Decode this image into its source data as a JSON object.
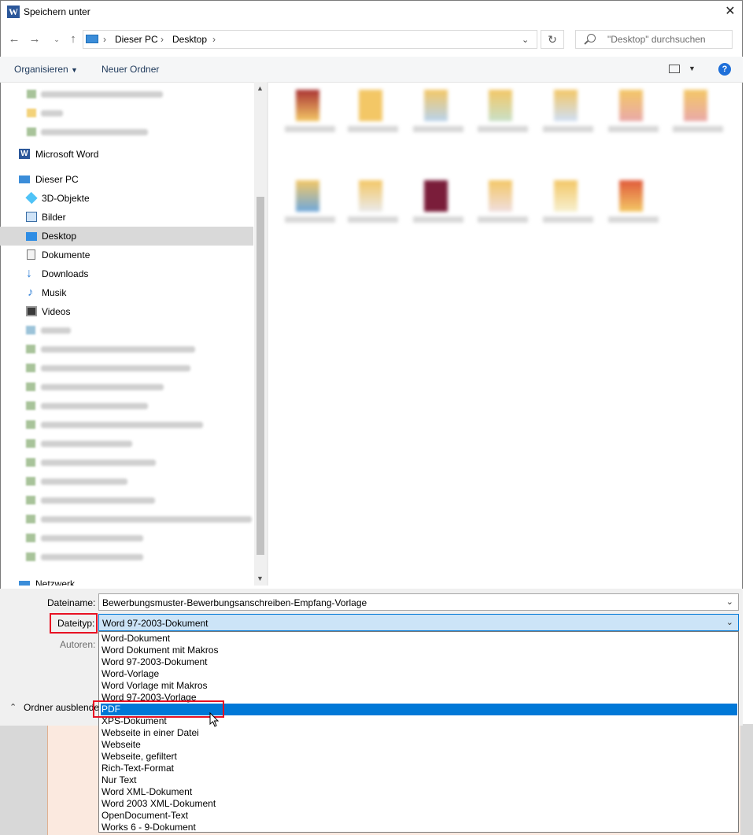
{
  "window": {
    "title": "Speichern unter",
    "app_icon": "W"
  },
  "breadcrumb": [
    "Dieser PC",
    "Desktop"
  ],
  "search": {
    "placeholder": "\"Desktop\" durchsuchen"
  },
  "toolbar": {
    "organize": "Organisieren",
    "new_folder": "Neuer Ordner"
  },
  "nav": {
    "microsoft_word": "Microsoft Word",
    "this_pc": "Dieser PC",
    "objects_3d": "3D-Objekte",
    "pictures": "Bilder",
    "desktop": "Desktop",
    "documents": "Dokumente",
    "downloads": "Downloads",
    "music": "Musik",
    "videos": "Videos",
    "network": "Netzwerk"
  },
  "form": {
    "filename_label": "Dateiname:",
    "filename_value": "Bewerbungsmuster-Bewerbungsanschreiben-Empfang-Vorlage",
    "filetype_label": "Dateityp:",
    "filetype_value": "Word 97-2003-Dokument",
    "authors_label": "Autoren:",
    "hide_folders": "Ordner ausblende"
  },
  "filetype_options": [
    "Word-Dokument",
    "Word Dokument mit Makros",
    "Word 97-2003-Dokument",
    "Word-Vorlage",
    "Word Vorlage mit Makros",
    "Word 97-2003-Vorlage",
    "PDF",
    "XPS-Dokument",
    "Webseite in einer Datei",
    "Webseite",
    "Webseite, gefiltert",
    "Rich-Text-Format",
    "Nur Text",
    "Word XML-Dokument",
    "Word 2003 XML-Dokument",
    "OpenDocument-Text",
    "Works 6 - 9-Dokument"
  ],
  "selected_option": "PDF",
  "colors": {
    "accent": "#0078d7",
    "highlight": "#e81123",
    "selection": "#d9d9d9"
  }
}
